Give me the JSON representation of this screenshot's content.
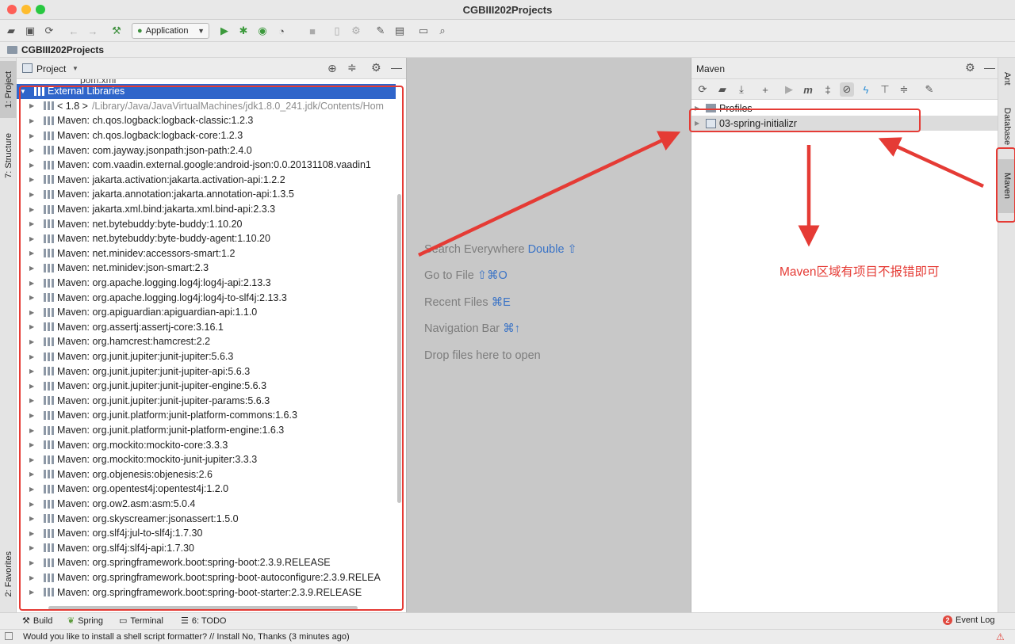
{
  "window": {
    "title": "CGBIII202Projects"
  },
  "toolbar": {
    "run_config": "Application"
  },
  "breadcrumb": {
    "project": "CGBIII202Projects"
  },
  "left_stripe": {
    "tabs": [
      "1: Project",
      "7: Structure",
      "2: Favorites"
    ]
  },
  "project_panel": {
    "title": "Project",
    "partial_row": "pom.xml",
    "tree": [
      {
        "label": "External Libraries",
        "selected": true
      },
      {
        "label": "< 1.8 >",
        "hint": "/Library/Java/JavaVirtualMachines/jdk1.8.0_241.jdk/Contents/Hom"
      },
      {
        "label": "Maven: ch.qos.logback:logback-classic:1.2.3"
      },
      {
        "label": "Maven: ch.qos.logback:logback-core:1.2.3"
      },
      {
        "label": "Maven: com.jayway.jsonpath:json-path:2.4.0"
      },
      {
        "label": "Maven: com.vaadin.external.google:android-json:0.0.20131108.vaadin1"
      },
      {
        "label": "Maven: jakarta.activation:jakarta.activation-api:1.2.2"
      },
      {
        "label": "Maven: jakarta.annotation:jakarta.annotation-api:1.3.5"
      },
      {
        "label": "Maven: jakarta.xml.bind:jakarta.xml.bind-api:2.3.3"
      },
      {
        "label": "Maven: net.bytebuddy:byte-buddy:1.10.20"
      },
      {
        "label": "Maven: net.bytebuddy:byte-buddy-agent:1.10.20"
      },
      {
        "label": "Maven: net.minidev:accessors-smart:1.2"
      },
      {
        "label": "Maven: net.minidev:json-smart:2.3"
      },
      {
        "label": "Maven: org.apache.logging.log4j:log4j-api:2.13.3"
      },
      {
        "label": "Maven: org.apache.logging.log4j:log4j-to-slf4j:2.13.3"
      },
      {
        "label": "Maven: org.apiguardian:apiguardian-api:1.1.0"
      },
      {
        "label": "Maven: org.assertj:assertj-core:3.16.1"
      },
      {
        "label": "Maven: org.hamcrest:hamcrest:2.2"
      },
      {
        "label": "Maven: org.junit.jupiter:junit-jupiter:5.6.3"
      },
      {
        "label": "Maven: org.junit.jupiter:junit-jupiter-api:5.6.3"
      },
      {
        "label": "Maven: org.junit.jupiter:junit-jupiter-engine:5.6.3"
      },
      {
        "label": "Maven: org.junit.jupiter:junit-jupiter-params:5.6.3"
      },
      {
        "label": "Maven: org.junit.platform:junit-platform-commons:1.6.3"
      },
      {
        "label": "Maven: org.junit.platform:junit-platform-engine:1.6.3"
      },
      {
        "label": "Maven: org.mockito:mockito-core:3.3.3"
      },
      {
        "label": "Maven: org.mockito:mockito-junit-jupiter:3.3.3"
      },
      {
        "label": "Maven: org.objenesis:objenesis:2.6"
      },
      {
        "label": "Maven: org.opentest4j:opentest4j:1.2.0"
      },
      {
        "label": "Maven: org.ow2.asm:asm:5.0.4"
      },
      {
        "label": "Maven: org.skyscreamer:jsonassert:1.5.0"
      },
      {
        "label": "Maven: org.slf4j:jul-to-slf4j:1.7.30"
      },
      {
        "label": "Maven: org.slf4j:slf4j-api:1.7.30"
      },
      {
        "label": "Maven: org.springframework.boot:spring-boot:2.3.9.RELEASE"
      },
      {
        "label": "Maven: org.springframework.boot:spring-boot-autoconfigure:2.3.9.RELEA"
      },
      {
        "label": "Maven: org.springframework.boot:spring-boot-starter:2.3.9.RELEASE"
      }
    ]
  },
  "editor": {
    "hints": [
      {
        "text": "Search Everywhere",
        "shortcut": "Double ⇧"
      },
      {
        "text": "Go to File",
        "shortcut": "⇧⌘O"
      },
      {
        "text": "Recent Files",
        "shortcut": "⌘E"
      },
      {
        "text": "Navigation Bar",
        "shortcut": "⌘↑"
      },
      {
        "text": "Drop files here to open",
        "shortcut": ""
      }
    ]
  },
  "maven_panel": {
    "title": "Maven",
    "tree": [
      {
        "label": "Profiles"
      },
      {
        "label": "03-spring-initializr"
      }
    ],
    "annotation": "Maven区域有项目不报错即可"
  },
  "right_stripe": {
    "tabs": [
      "Ant",
      "Database",
      "Maven"
    ]
  },
  "bottom_tabs": {
    "build": "Build",
    "spring": "Spring",
    "terminal": "Terminal",
    "todo": "6: TODO",
    "event_log": "Event Log",
    "event_count": "2"
  },
  "status": {
    "message": "Would you like to install a shell script formatter? // Install   No, Thanks (3 minutes ago)"
  },
  "colors": {
    "selection": "#2f65ca",
    "annotation_red": "#e53b35",
    "editor_bg": "#c8c8c8"
  }
}
